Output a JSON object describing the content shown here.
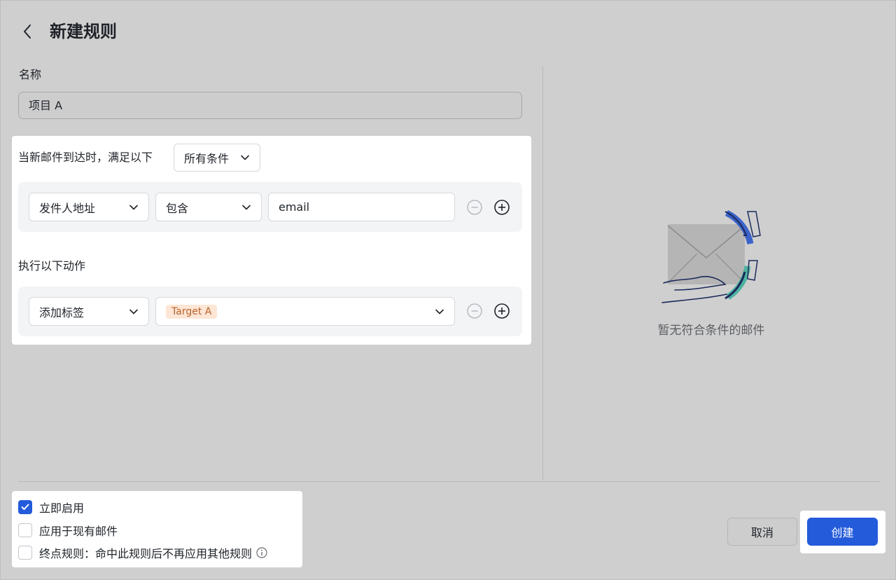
{
  "header": {
    "title": "新建规则"
  },
  "name_field": {
    "label": "名称",
    "value": "项目 A"
  },
  "conditions": {
    "intro": "当新邮件到达时，满足以下",
    "match_mode": "所有条件",
    "rows": [
      {
        "field": "发件人地址",
        "operator": "包含",
        "value": "email"
      }
    ]
  },
  "actions": {
    "label": "执行以下动作",
    "rows": [
      {
        "action": "添加标签",
        "tag": "Target A"
      }
    ]
  },
  "preview": {
    "empty_text": "暂无符合条件的邮件"
  },
  "options": [
    {
      "label": "立即启用",
      "checked": true
    },
    {
      "label": "应用于现有邮件",
      "checked": false
    },
    {
      "label": "终点规则：命中此规则后不再应用其他规则",
      "checked": false
    }
  ],
  "footer": {
    "cancel_label": "取消",
    "create_label": "创建"
  },
  "colors": {
    "primary": "#245bdb",
    "tag_bg": "#fde6d6",
    "tag_text": "#b8632a",
    "art_blue": "#3b63c9",
    "art_teal": "#4db3a0",
    "art_navy": "#1c2a5b"
  },
  "icons": [
    "chevron-left-icon",
    "chevron-down-icon",
    "minus-circle-icon",
    "plus-circle-icon",
    "check-icon",
    "info-icon",
    "empty-mail-illustration"
  ]
}
